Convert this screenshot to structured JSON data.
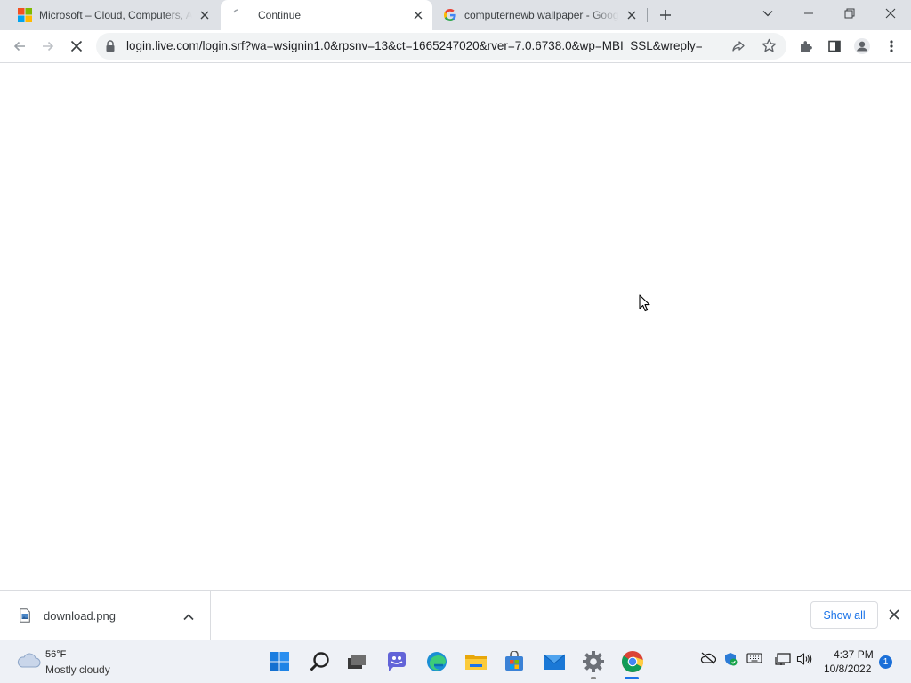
{
  "browser": {
    "tabs": [
      {
        "title": "Microsoft – Cloud, Computers, Apps",
        "favicon": "microsoft-logo-icon",
        "active": false
      },
      {
        "title": "Continue",
        "favicon": "loading-spinner-icon",
        "active": true
      },
      {
        "title": "computernewb wallpaper - Google Search",
        "favicon": "google-logo-icon",
        "active": false
      }
    ],
    "url": "login.live.com/login.srf?wa=wsignin1.0&rpsnv=13&ct=1665247020&rver=7.0.6738.0&wp=MBI_SSL&wreply=",
    "loading": true
  },
  "download_bar": {
    "items": [
      {
        "filename": "download.png",
        "icon": "image-file-icon"
      }
    ],
    "show_all_label": "Show all"
  },
  "taskbar": {
    "weather": {
      "temp": "56°F",
      "desc": "Mostly cloudy"
    },
    "pinned": [
      "start-icon",
      "search-icon",
      "task-view-icon",
      "chat-icon",
      "edge-icon",
      "file-explorer-icon",
      "store-icon",
      "mail-icon",
      "settings-icon",
      "chrome-icon"
    ],
    "tray": [
      "onedrive-offline-icon",
      "windows-security-icon",
      "keyboard-icon",
      "network-icon",
      "volume-icon"
    ],
    "clock": {
      "time": "4:37 PM",
      "date": "10/8/2022"
    },
    "notification_count": "1"
  },
  "colors": {
    "tabstrip_bg": "#dee1e6",
    "omnibox_bg": "#f1f3f4",
    "accent_blue": "#1a73e8",
    "taskbar_bg": "#eef1f6"
  }
}
